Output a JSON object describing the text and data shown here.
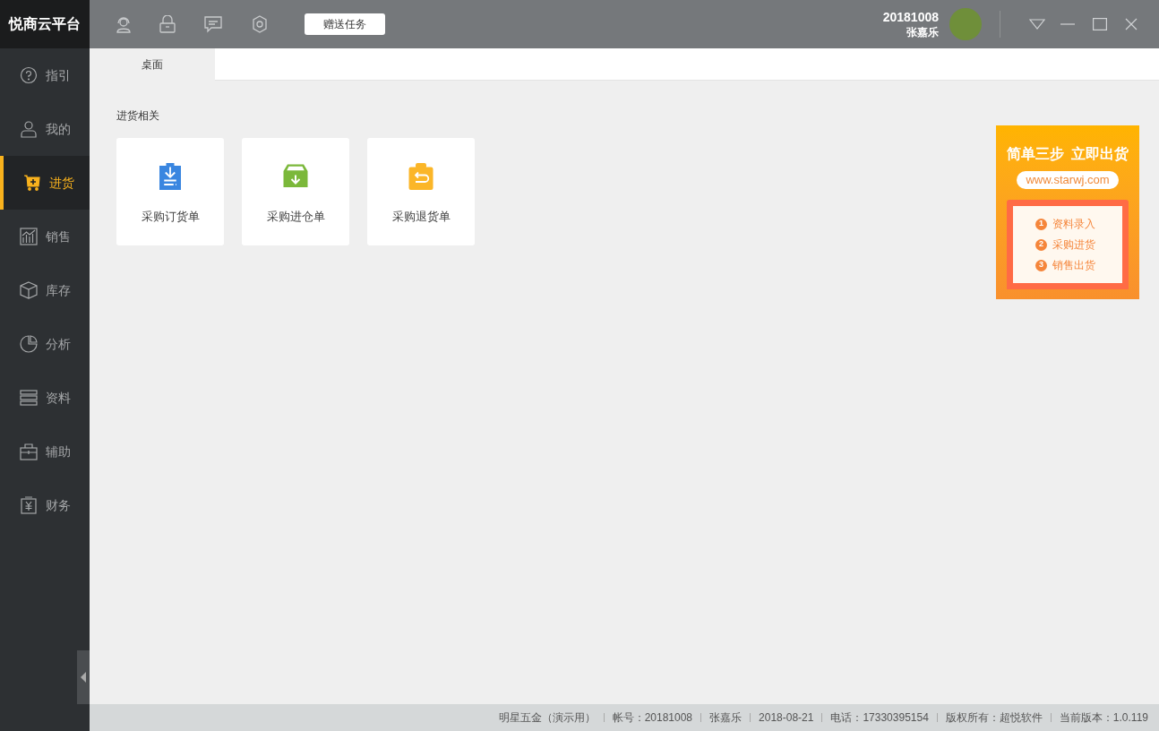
{
  "app": {
    "logo": "悦商云平台"
  },
  "toolbar": {
    "gift_button": "赠送任务"
  },
  "user": {
    "account": "20181008",
    "name": "张嘉乐"
  },
  "sidebar": {
    "items": [
      {
        "label": "指引",
        "selected": false
      },
      {
        "label": "我的",
        "selected": false
      },
      {
        "label": "进货",
        "selected": true
      },
      {
        "label": "销售",
        "selected": false
      },
      {
        "label": "库存",
        "selected": false
      },
      {
        "label": "分析",
        "selected": false
      },
      {
        "label": "资料",
        "selected": false
      },
      {
        "label": "辅助",
        "selected": false
      },
      {
        "label": "财务",
        "selected": false
      }
    ]
  },
  "tabs": [
    {
      "label": "桌面",
      "selected": true
    }
  ],
  "section": {
    "title": "进货相关",
    "cards": [
      {
        "label": "采购订货单",
        "color": "#3a86e0"
      },
      {
        "label": "采购进仓单",
        "color": "#7bb83a"
      },
      {
        "label": "采购退货单",
        "color": "#fbb628"
      }
    ]
  },
  "banner": {
    "headline": "简单三步  立即出货",
    "url": "www.starwj.com",
    "steps": [
      {
        "number": "1",
        "label": "资料录入"
      },
      {
        "number": "2",
        "label": "采购进货"
      },
      {
        "number": "3",
        "label": "销售出货"
      }
    ]
  },
  "status_bar": [
    "明星五金（演示用）",
    "帐号：20181008",
    "张嘉乐",
    "2018-08-21",
    "电话：17330395154",
    "版权所有：超悦软件",
    "当前版本：1.0.119"
  ]
}
